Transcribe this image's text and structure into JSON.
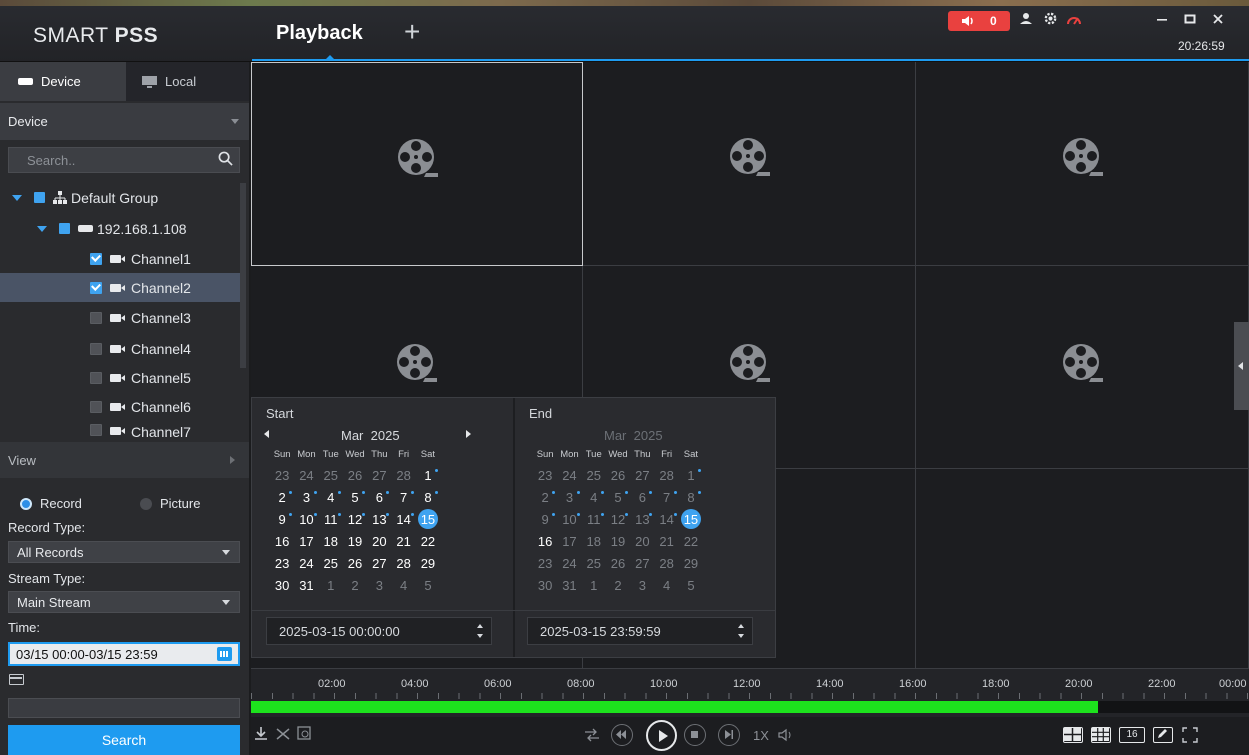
{
  "app": {
    "name_light": "SMART ",
    "name_bold": "PSS",
    "tab": "Playback",
    "add_tab": "+",
    "clock": "20:26:59",
    "alarm_count": "0"
  },
  "left": {
    "tabs": [
      {
        "label": "Device"
      },
      {
        "label": "Local"
      }
    ],
    "device_dropdown": "Device",
    "search_placeholder": "Search..",
    "tree": {
      "group": "Default Group",
      "device": "192.168.1.108",
      "channels": [
        "Channel1",
        "Channel2",
        "Channel3",
        "Channel4",
        "Channel5",
        "Channel6",
        "Channel7"
      ]
    },
    "view_label": "View",
    "mode_record": "Record",
    "mode_picture": "Picture",
    "record_type_label": "Record Type:",
    "record_type_value": "All Records",
    "stream_type_label": "Stream Type:",
    "stream_type_value": "Main Stream",
    "time_label": "Time:",
    "time_value": "03/15 00:00-03/15 23:59",
    "search_button": "Search"
  },
  "calendar": {
    "start": {
      "title": "Start",
      "month": "Mar",
      "year": "2025",
      "datetime": "2025-03-15 00:00:00"
    },
    "end": {
      "title": "End",
      "month": "Mar",
      "year": "2025",
      "datetime": "2025-03-15 23:59:59"
    },
    "weekdays": [
      "Sun",
      "Mon",
      "Tue",
      "Wed",
      "Thu",
      "Fri",
      "Sat"
    ],
    "days": [
      [
        "23",
        "24",
        "25",
        "26",
        "27",
        "28",
        "1"
      ],
      [
        "2",
        "3",
        "4",
        "5",
        "6",
        "7",
        "8"
      ],
      [
        "9",
        "10",
        "11",
        "12",
        "13",
        "14",
        "15"
      ],
      [
        "16",
        "17",
        "18",
        "19",
        "20",
        "21",
        "22"
      ],
      [
        "23",
        "24",
        "25",
        "26",
        "27",
        "28",
        "29"
      ],
      [
        "30",
        "31",
        "1",
        "2",
        "3",
        "4",
        "5"
      ]
    ],
    "selected_day": "15"
  },
  "timeline": {
    "labels": [
      "02:00",
      "04:00",
      "06:00",
      "08:00",
      "10:00",
      "12:00",
      "14:00",
      "16:00",
      "18:00",
      "20:00",
      "22:00",
      "00:00"
    ],
    "recorded_fraction": 0.849,
    "record_color": "#1de21d"
  },
  "controls": {
    "speed": "1X",
    "layout_16": "16"
  },
  "colors": {
    "accent": "#1e9bf0",
    "alarm": "#e9413f"
  }
}
